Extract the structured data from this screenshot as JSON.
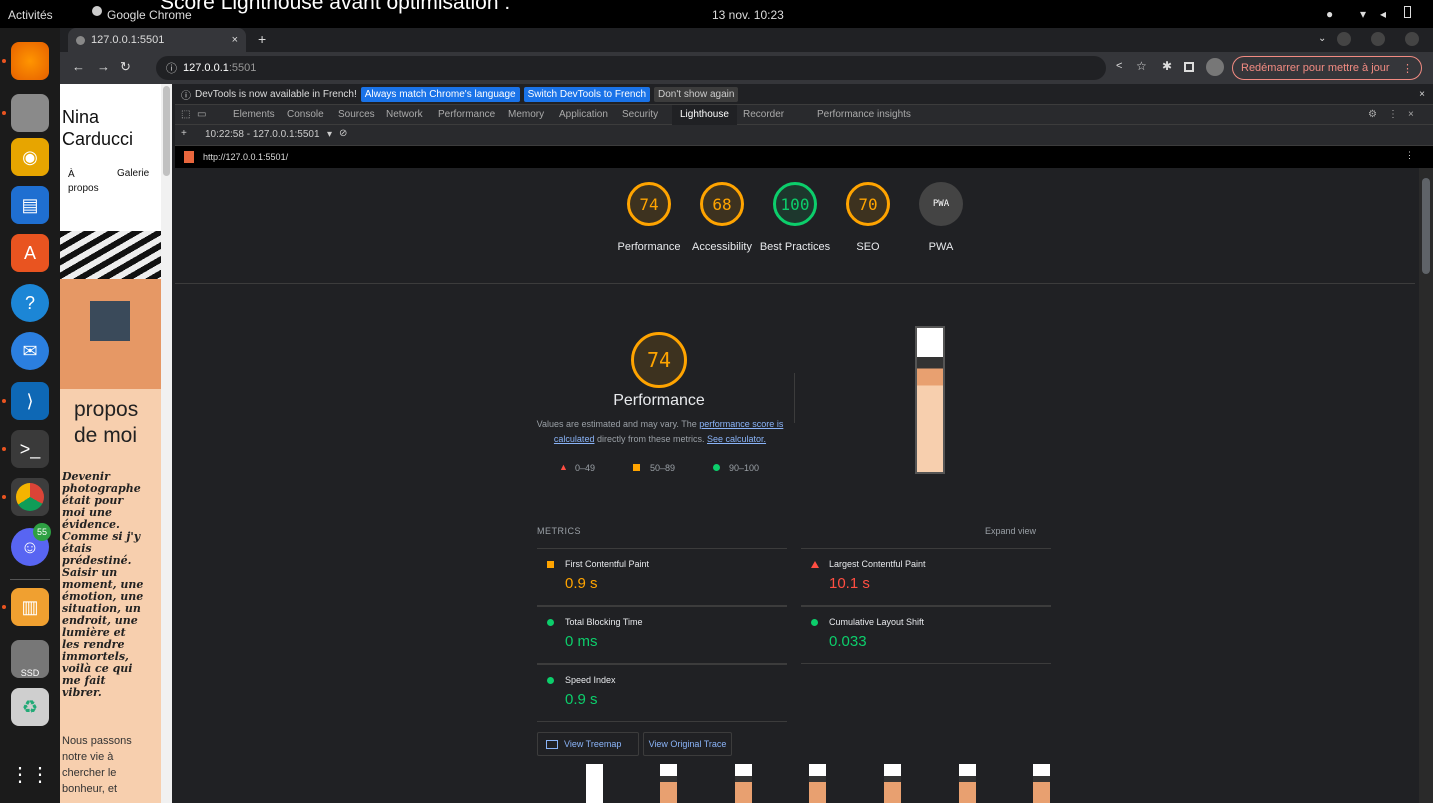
{
  "overlay_title": "Score Lighthouse avant optimisation :",
  "topbar": {
    "activities": "Activités",
    "app": "Google Chrome",
    "datetime": "13 nov. 10:23"
  },
  "dock": {
    "badge": "55",
    "ssd_label": "SSD"
  },
  "browser": {
    "tab_title": "127.0.0.1:5501",
    "url_host": "127.0.0.1",
    "url_port": ":5501",
    "update_button": "Redémarrer pour mettre à jour"
  },
  "site": {
    "name_line1": "Nina",
    "name_line2": "Carducci",
    "nav_about": "À propos",
    "nav_gallery": "Galerie",
    "about_title_1": "propos",
    "about_title_2": "de moi",
    "quote": "Devenir photographe était pour moi une évidence. Comme si j'y étais prédestiné. Saisir un moment, une émotion, une situation, un endroit, une lumière et les rendre immortels, voilà ce qui me fait vibrer.",
    "body": "Nous passons notre vie à chercher le bonheur, et"
  },
  "devtools": {
    "infobar_text": "DevTools is now available in French!",
    "infobar_btn1": "Always match Chrome's language",
    "infobar_btn2": "Switch DevTools to French",
    "infobar_btn3": "Don't show again",
    "tabs": [
      "Elements",
      "Console",
      "Sources",
      "Network",
      "Performance",
      "Memory",
      "Application",
      "Security",
      "Lighthouse",
      "Recorder",
      "Performance insights"
    ],
    "report_select": "10:22:58 - 127.0.0.1:5501",
    "report_url": "http://127.0.0.1:5501/"
  },
  "scores": [
    {
      "value": "74",
      "label": "Performance",
      "color": "#ffa400"
    },
    {
      "value": "68",
      "label": "Accessibility",
      "color": "#ffa400"
    },
    {
      "value": "100",
      "label": "Best Practices",
      "color": "#0cce6b"
    },
    {
      "value": "70",
      "label": "SEO",
      "color": "#ffa400"
    },
    {
      "value": "PWA",
      "label": "PWA",
      "color": "#9aa0a6"
    }
  ],
  "perf": {
    "score": "74",
    "title": "Performance",
    "desc_1": "Values are estimated and may vary. The",
    "desc_link1": "performance score is calculated",
    "desc_2": "directly from these metrics.",
    "desc_link2": "See calculator.",
    "legend": [
      "0–49",
      "50–89",
      "90–100"
    ]
  },
  "metrics": {
    "header": "METRICS",
    "expand": "Expand view",
    "items": [
      {
        "name": "First Contentful Paint",
        "value": "0.9 s",
        "color": "#ffa400",
        "shape": "square"
      },
      {
        "name": "Largest Contentful Paint",
        "value": "10.1 s",
        "color": "#ff4e42",
        "shape": "triangle"
      },
      {
        "name": "Total Blocking Time",
        "value": "0 ms",
        "color": "#0cce6b",
        "shape": "circle"
      },
      {
        "name": "Cumulative Layout Shift",
        "value": "0.033",
        "color": "#0cce6b",
        "shape": "circle"
      },
      {
        "name": "Speed Index",
        "value": "0.9 s",
        "color": "#0cce6b",
        "shape": "circle"
      }
    ]
  },
  "buttons": {
    "treemap": "View Treemap",
    "trace": "View Original Trace"
  }
}
